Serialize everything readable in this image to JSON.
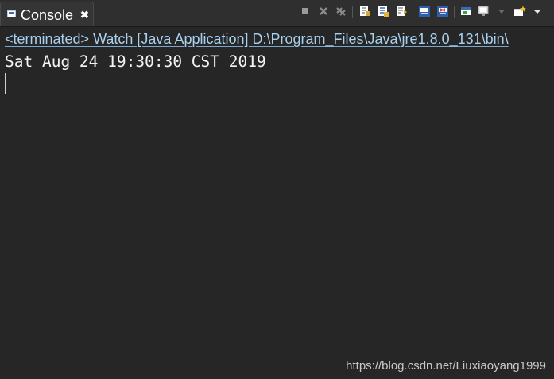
{
  "tab": {
    "icon": "console-icon",
    "label": "Console",
    "close_icon": "close-icon",
    "close_glyph": "✖"
  },
  "toolbar": [
    {
      "icon": "terminate-icon"
    },
    {
      "icon": "remove-launch-icon"
    },
    {
      "icon": "remove-all-terminated-icon"
    },
    {
      "icon": "clear-console-icon"
    },
    {
      "icon": "scroll-lock-icon"
    },
    {
      "icon": "word-wrap-icon"
    },
    {
      "icon": "show-on-stdout-icon"
    },
    {
      "icon": "show-on-stderr-icon"
    },
    {
      "icon": "pin-console-icon"
    },
    {
      "icon": "display-selected-console-icon"
    },
    {
      "icon": "dropdown-arrow-icon"
    },
    {
      "icon": "open-console-icon"
    },
    {
      "icon": "view-menu-icon"
    }
  ],
  "console": {
    "header": "<terminated> Watch [Java Application] D:\\Program_Files\\Java\\jre1.8.0_131\\bin\\",
    "lines": [
      "Sat Aug 24 19:30:30 CST 2019"
    ]
  },
  "watermark": "https://blog.csdn.net/Liuxiaoyang1999",
  "colors": {
    "background": "#262626",
    "header_text": "#a9d1ef",
    "output_text": "#f4f4f4"
  }
}
